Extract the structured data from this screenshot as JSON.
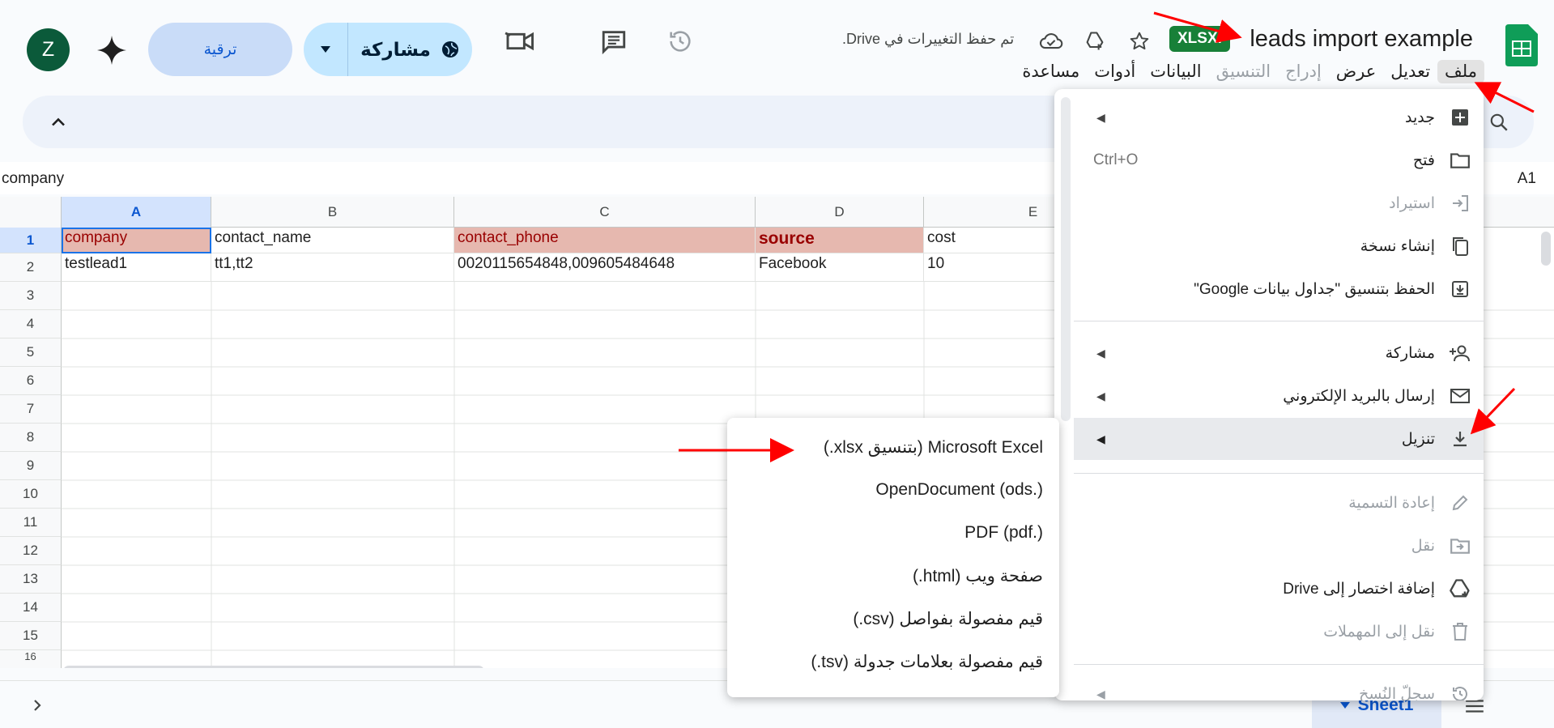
{
  "header": {
    "doc_title": "leads import example",
    "file_badge": "XLSX.",
    "save_status": "تم حفظ التغييرات في Drive.",
    "avatar_letter": "Z",
    "upgrade_label": "ترقية",
    "share_label": "مشاركة"
  },
  "menu_bar": [
    "ملف",
    "تعديل",
    "عرض",
    "إدراج",
    "التنسيق",
    "البيانات",
    "أدوات",
    "مساعدة"
  ],
  "formula_bar": {
    "name_box": "A1",
    "value": "company"
  },
  "grid": {
    "columns": [
      "A",
      "B",
      "C",
      "D",
      "E"
    ],
    "rows": [
      "1",
      "2",
      "3",
      "4",
      "5",
      "6",
      "7",
      "8",
      "9",
      "10",
      "11",
      "12",
      "13",
      "14",
      "15",
      "16"
    ],
    "row1": [
      "company",
      "contact_name",
      "contact_phone",
      "source",
      "cost"
    ],
    "row2": [
      "testlead1",
      "tt1,tt2",
      "0020115654848,009605484648",
      "Facebook",
      "10"
    ]
  },
  "bottom_bar": {
    "sheet_tab": "Sheet1"
  },
  "file_menu": {
    "new": "جديد",
    "open": "فتح",
    "open_shortcut": "Ctrl+O",
    "import": "استيراد",
    "make_copy": "إنشاء نسخة",
    "save_as_sheets": "الحفظ بتنسيق \"جداول بيانات Google\"",
    "share": "مشاركة",
    "email": "إرسال بالبريد الإلكتروني",
    "download": "تنزيل",
    "rename": "إعادة التسمية",
    "move": "نقل",
    "add_shortcut": "إضافة اختصار إلى Drive",
    "trash": "نقل إلى المهملات",
    "version_history": "سجلّ النُسخ"
  },
  "download_submenu": {
    "xlsx": "Microsoft Excel (بتنسيق xlsx.)",
    "ods": "OpenDocument (ods.)",
    "pdf": "PDF (pdf.)",
    "html": "صفحة ويب (html.)",
    "csv": "قيم مفصولة بفواصل (csv.)",
    "tsv": "قيم مفصولة بعلامات جدولة (tsv.)"
  },
  "colors": {
    "accent_blue": "#0b57d0",
    "sheets_green": "#188038",
    "header_highlight": "#e6b8af",
    "annotation_red": "#ff0000"
  }
}
